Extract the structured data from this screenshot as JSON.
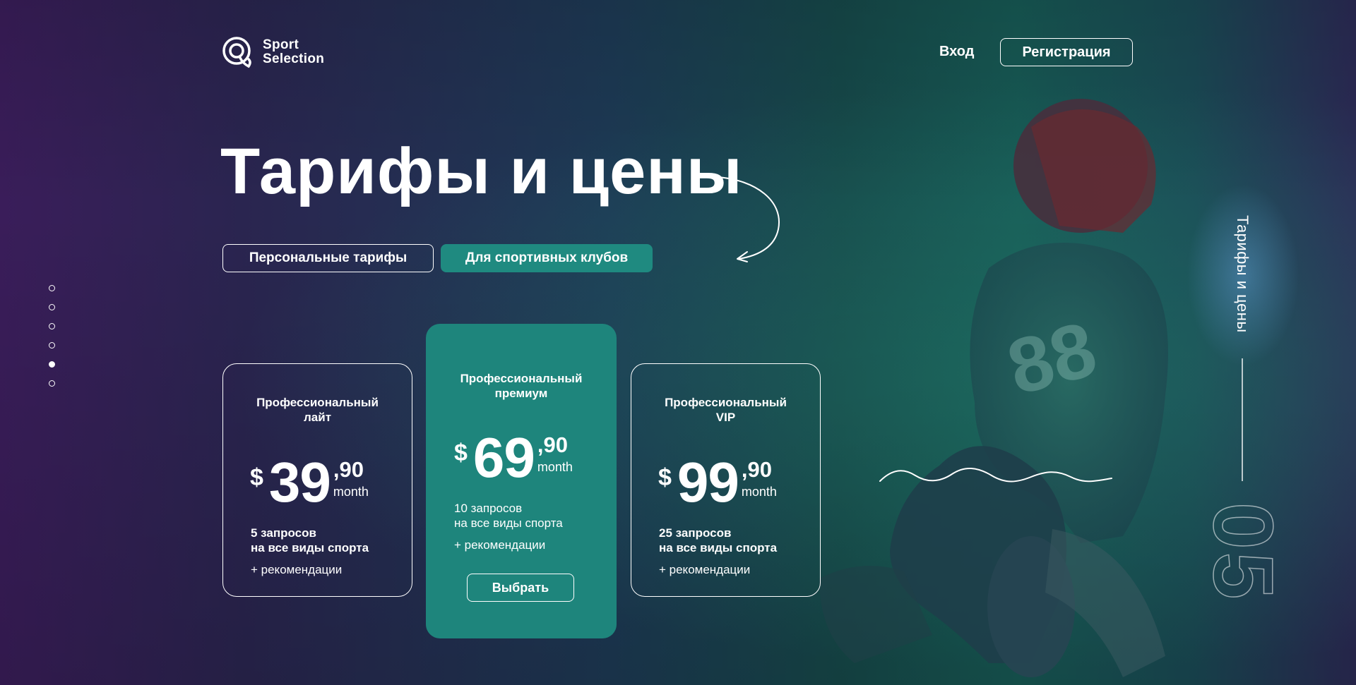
{
  "brand": {
    "name_line1": "Sport",
    "name_line2": "Selection"
  },
  "header": {
    "login": "Вход",
    "register": "Регистрация"
  },
  "page": {
    "title": "Тарифы и цены"
  },
  "tabs": [
    {
      "label": "Персональные тарифы",
      "selected": false
    },
    {
      "label": "Для спортивных клубов",
      "selected": true
    }
  ],
  "pagination": {
    "total": 6,
    "active_index": 4
  },
  "plans": [
    {
      "name": "Профессиональный лайт",
      "currency": "$",
      "price_main": "39",
      "price_cents": ",90",
      "period": "month",
      "requests": "5 запросов",
      "scope": "на все виды спорта",
      "extra": "+ рекомендации"
    },
    {
      "name": "Профессиональный премиум",
      "currency": "$",
      "price_main": "69",
      "price_cents": ",90",
      "period": "month",
      "requests": "10 запросов",
      "scope": "на все виды спорта",
      "extra": "+ рекомендации",
      "button": "Выбрать"
    },
    {
      "name": "Профессиональный VIP",
      "currency": "$",
      "price_main": "99",
      "price_cents": ",90",
      "period": "month",
      "requests": "25 запросов",
      "scope": "на все виды спорта",
      "extra": "+ рекомендации"
    }
  ],
  "side": {
    "label": "Тарифы и цены",
    "section_number": "05"
  },
  "colors": {
    "accent": "#1e857c",
    "text": "#ffffff"
  },
  "icons": [
    "logo-icon",
    "curved-arrow-icon",
    "wave-decoration"
  ]
}
